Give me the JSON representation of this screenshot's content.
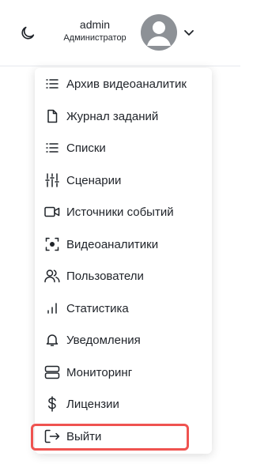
{
  "header": {
    "user_name": "admin",
    "user_role": "Администратор",
    "theme_icon": "moon-icon",
    "avatar_icon": "user-avatar-icon",
    "dropdown_icon": "chevron-down-icon"
  },
  "menu": {
    "items": [
      {
        "label": "Архив видеоаналитик",
        "icon": "list-icon"
      },
      {
        "label": "Журнал заданий",
        "icon": "document-icon"
      },
      {
        "label": "Списки",
        "icon": "list-icon"
      },
      {
        "label": "Сценарии",
        "icon": "sliders-icon"
      },
      {
        "label": "Источники событий",
        "icon": "video-camera-icon"
      },
      {
        "label": "Видеоаналитики",
        "icon": "focus-icon"
      },
      {
        "label": "Пользователи",
        "icon": "users-icon"
      },
      {
        "label": "Статистика",
        "icon": "bar-chart-icon"
      },
      {
        "label": "Уведомления",
        "icon": "bell-icon"
      },
      {
        "label": "Мониторинг",
        "icon": "server-icon"
      },
      {
        "label": "Лицензии",
        "icon": "dollar-icon"
      },
      {
        "label": "Выйти",
        "icon": "logout-icon"
      }
    ]
  },
  "colors": {
    "highlight": "#ef5350",
    "avatar_bg": "#8d9196",
    "text": "#1f2329"
  }
}
